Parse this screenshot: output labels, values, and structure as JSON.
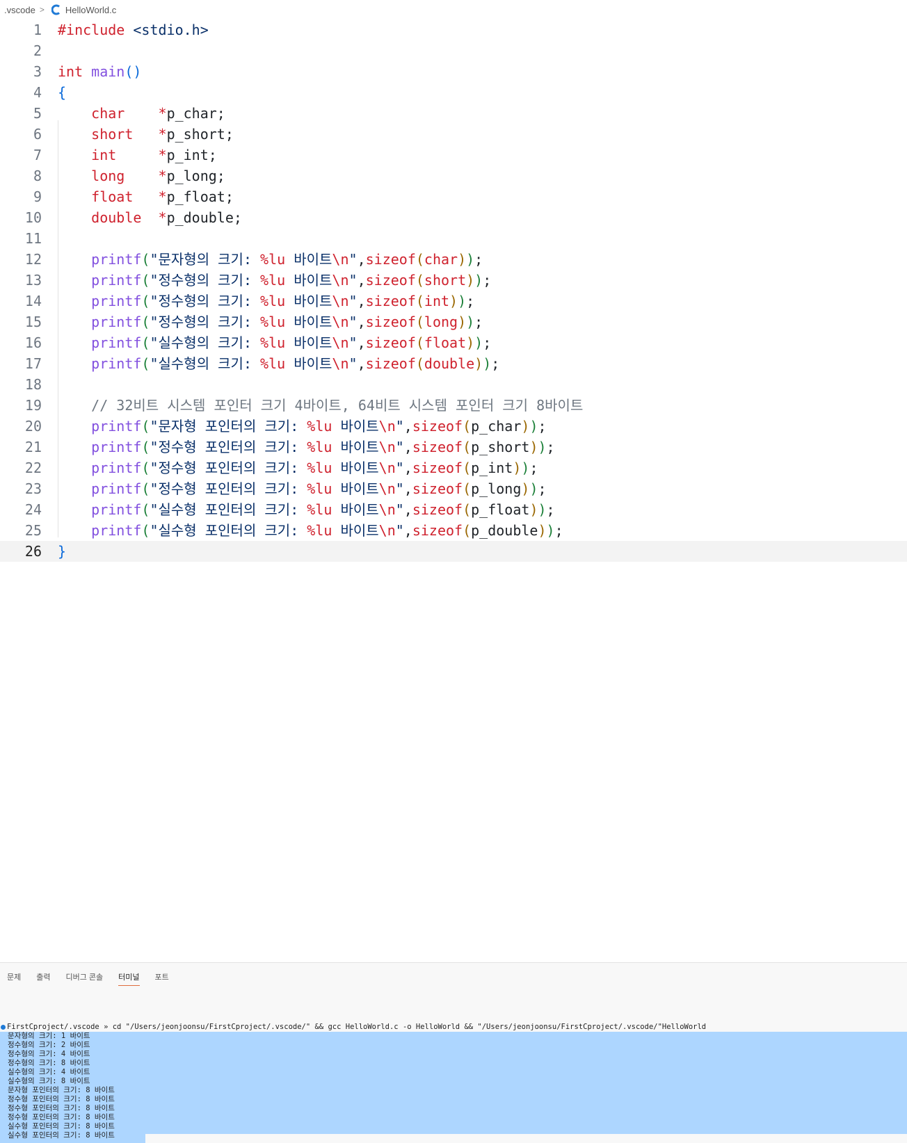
{
  "breadcrumb": {
    "folder": ".vscode",
    "file": "HelloWorld.c"
  },
  "editor": {
    "current_line": 26,
    "lines": [
      [
        {
          "t": "#include ",
          "c": "pp"
        },
        {
          "t": "<stdio.h>",
          "c": "str"
        }
      ],
      [],
      [
        {
          "t": "int",
          "c": "kw"
        },
        {
          "t": " ",
          "c": "id"
        },
        {
          "t": "main",
          "c": "fn"
        },
        {
          "t": "()",
          "c": "b1"
        }
      ],
      [
        {
          "t": "{",
          "c": "b1"
        }
      ],
      [
        {
          "t": "    ",
          "c": "id"
        },
        {
          "t": "char",
          "c": "kw"
        },
        {
          "t": "    ",
          "c": "id"
        },
        {
          "t": "*",
          "c": "ptr"
        },
        {
          "t": "p_char;",
          "c": "id"
        }
      ],
      [
        {
          "t": "    ",
          "c": "id"
        },
        {
          "t": "short",
          "c": "kw"
        },
        {
          "t": "   ",
          "c": "id"
        },
        {
          "t": "*",
          "c": "ptr"
        },
        {
          "t": "p_short;",
          "c": "id"
        }
      ],
      [
        {
          "t": "    ",
          "c": "id"
        },
        {
          "t": "int",
          "c": "kw"
        },
        {
          "t": "     ",
          "c": "id"
        },
        {
          "t": "*",
          "c": "ptr"
        },
        {
          "t": "p_int;",
          "c": "id"
        }
      ],
      [
        {
          "t": "    ",
          "c": "id"
        },
        {
          "t": "long",
          "c": "kw"
        },
        {
          "t": "    ",
          "c": "id"
        },
        {
          "t": "*",
          "c": "ptr"
        },
        {
          "t": "p_long;",
          "c": "id"
        }
      ],
      [
        {
          "t": "    ",
          "c": "id"
        },
        {
          "t": "float",
          "c": "kw"
        },
        {
          "t": "   ",
          "c": "id"
        },
        {
          "t": "*",
          "c": "ptr"
        },
        {
          "t": "p_float;",
          "c": "id"
        }
      ],
      [
        {
          "t": "    ",
          "c": "id"
        },
        {
          "t": "double",
          "c": "kw"
        },
        {
          "t": "  ",
          "c": "id"
        },
        {
          "t": "*",
          "c": "ptr"
        },
        {
          "t": "p_double;",
          "c": "id"
        }
      ],
      [],
      [
        {
          "t": "    ",
          "c": "id"
        },
        {
          "t": "printf",
          "c": "fn"
        },
        {
          "t": "(",
          "c": "b2"
        },
        {
          "t": "\"문자형의 크기: ",
          "c": "str"
        },
        {
          "t": "%lu",
          "c": "esc"
        },
        {
          "t": " 바이트",
          "c": "str"
        },
        {
          "t": "\\n",
          "c": "esc"
        },
        {
          "t": "\"",
          "c": "str"
        },
        {
          "t": ",",
          "c": "id"
        },
        {
          "t": "sizeof",
          "c": "kw"
        },
        {
          "t": "(",
          "c": "b3"
        },
        {
          "t": "char",
          "c": "kw"
        },
        {
          "t": ")",
          "c": "b3"
        },
        {
          "t": ")",
          "c": "b2"
        },
        {
          "t": ";",
          "c": "id"
        }
      ],
      [
        {
          "t": "    ",
          "c": "id"
        },
        {
          "t": "printf",
          "c": "fn"
        },
        {
          "t": "(",
          "c": "b2"
        },
        {
          "t": "\"정수형의 크기: ",
          "c": "str"
        },
        {
          "t": "%lu",
          "c": "esc"
        },
        {
          "t": " 바이트",
          "c": "str"
        },
        {
          "t": "\\n",
          "c": "esc"
        },
        {
          "t": "\"",
          "c": "str"
        },
        {
          "t": ",",
          "c": "id"
        },
        {
          "t": "sizeof",
          "c": "kw"
        },
        {
          "t": "(",
          "c": "b3"
        },
        {
          "t": "short",
          "c": "kw"
        },
        {
          "t": ")",
          "c": "b3"
        },
        {
          "t": ")",
          "c": "b2"
        },
        {
          "t": ";",
          "c": "id"
        }
      ],
      [
        {
          "t": "    ",
          "c": "id"
        },
        {
          "t": "printf",
          "c": "fn"
        },
        {
          "t": "(",
          "c": "b2"
        },
        {
          "t": "\"정수형의 크기: ",
          "c": "str"
        },
        {
          "t": "%lu",
          "c": "esc"
        },
        {
          "t": " 바이트",
          "c": "str"
        },
        {
          "t": "\\n",
          "c": "esc"
        },
        {
          "t": "\"",
          "c": "str"
        },
        {
          "t": ",",
          "c": "id"
        },
        {
          "t": "sizeof",
          "c": "kw"
        },
        {
          "t": "(",
          "c": "b3"
        },
        {
          "t": "int",
          "c": "kw"
        },
        {
          "t": ")",
          "c": "b3"
        },
        {
          "t": ")",
          "c": "b2"
        },
        {
          "t": ";",
          "c": "id"
        }
      ],
      [
        {
          "t": "    ",
          "c": "id"
        },
        {
          "t": "printf",
          "c": "fn"
        },
        {
          "t": "(",
          "c": "b2"
        },
        {
          "t": "\"정수형의 크기: ",
          "c": "str"
        },
        {
          "t": "%lu",
          "c": "esc"
        },
        {
          "t": " 바이트",
          "c": "str"
        },
        {
          "t": "\\n",
          "c": "esc"
        },
        {
          "t": "\"",
          "c": "str"
        },
        {
          "t": ",",
          "c": "id"
        },
        {
          "t": "sizeof",
          "c": "kw"
        },
        {
          "t": "(",
          "c": "b3"
        },
        {
          "t": "long",
          "c": "kw"
        },
        {
          "t": ")",
          "c": "b3"
        },
        {
          "t": ")",
          "c": "b2"
        },
        {
          "t": ";",
          "c": "id"
        }
      ],
      [
        {
          "t": "    ",
          "c": "id"
        },
        {
          "t": "printf",
          "c": "fn"
        },
        {
          "t": "(",
          "c": "b2"
        },
        {
          "t": "\"실수형의 크기: ",
          "c": "str"
        },
        {
          "t": "%lu",
          "c": "esc"
        },
        {
          "t": " 바이트",
          "c": "str"
        },
        {
          "t": "\\n",
          "c": "esc"
        },
        {
          "t": "\"",
          "c": "str"
        },
        {
          "t": ",",
          "c": "id"
        },
        {
          "t": "sizeof",
          "c": "kw"
        },
        {
          "t": "(",
          "c": "b3"
        },
        {
          "t": "float",
          "c": "kw"
        },
        {
          "t": ")",
          "c": "b3"
        },
        {
          "t": ")",
          "c": "b2"
        },
        {
          "t": ";",
          "c": "id"
        }
      ],
      [
        {
          "t": "    ",
          "c": "id"
        },
        {
          "t": "printf",
          "c": "fn"
        },
        {
          "t": "(",
          "c": "b2"
        },
        {
          "t": "\"실수형의 크기: ",
          "c": "str"
        },
        {
          "t": "%lu",
          "c": "esc"
        },
        {
          "t": " 바이트",
          "c": "str"
        },
        {
          "t": "\\n",
          "c": "esc"
        },
        {
          "t": "\"",
          "c": "str"
        },
        {
          "t": ",",
          "c": "id"
        },
        {
          "t": "sizeof",
          "c": "kw"
        },
        {
          "t": "(",
          "c": "b3"
        },
        {
          "t": "double",
          "c": "kw"
        },
        {
          "t": ")",
          "c": "b3"
        },
        {
          "t": ")",
          "c": "b2"
        },
        {
          "t": ";",
          "c": "id"
        }
      ],
      [],
      [
        {
          "t": "    ",
          "c": "id"
        },
        {
          "t": "// 32비트 시스템 포인터 크기 4바이트, 64비트 시스템 포인터 크기 8바이트",
          "c": "cm"
        }
      ],
      [
        {
          "t": "    ",
          "c": "id"
        },
        {
          "t": "printf",
          "c": "fn"
        },
        {
          "t": "(",
          "c": "b2"
        },
        {
          "t": "\"문자형 포인터의 크기: ",
          "c": "str"
        },
        {
          "t": "%lu",
          "c": "esc"
        },
        {
          "t": " 바이트",
          "c": "str"
        },
        {
          "t": "\\n",
          "c": "esc"
        },
        {
          "t": "\"",
          "c": "str"
        },
        {
          "t": ",",
          "c": "id"
        },
        {
          "t": "sizeof",
          "c": "kw"
        },
        {
          "t": "(",
          "c": "b3"
        },
        {
          "t": "p_char",
          "c": "id"
        },
        {
          "t": ")",
          "c": "b3"
        },
        {
          "t": ")",
          "c": "b2"
        },
        {
          "t": ";",
          "c": "id"
        }
      ],
      [
        {
          "t": "    ",
          "c": "id"
        },
        {
          "t": "printf",
          "c": "fn"
        },
        {
          "t": "(",
          "c": "b2"
        },
        {
          "t": "\"정수형 포인터의 크기: ",
          "c": "str"
        },
        {
          "t": "%lu",
          "c": "esc"
        },
        {
          "t": " 바이트",
          "c": "str"
        },
        {
          "t": "\\n",
          "c": "esc"
        },
        {
          "t": "\"",
          "c": "str"
        },
        {
          "t": ",",
          "c": "id"
        },
        {
          "t": "sizeof",
          "c": "kw"
        },
        {
          "t": "(",
          "c": "b3"
        },
        {
          "t": "p_short",
          "c": "id"
        },
        {
          "t": ")",
          "c": "b3"
        },
        {
          "t": ")",
          "c": "b2"
        },
        {
          "t": ";",
          "c": "id"
        }
      ],
      [
        {
          "t": "    ",
          "c": "id"
        },
        {
          "t": "printf",
          "c": "fn"
        },
        {
          "t": "(",
          "c": "b2"
        },
        {
          "t": "\"정수형 포인터의 크기: ",
          "c": "str"
        },
        {
          "t": "%lu",
          "c": "esc"
        },
        {
          "t": " 바이트",
          "c": "str"
        },
        {
          "t": "\\n",
          "c": "esc"
        },
        {
          "t": "\"",
          "c": "str"
        },
        {
          "t": ",",
          "c": "id"
        },
        {
          "t": "sizeof",
          "c": "kw"
        },
        {
          "t": "(",
          "c": "b3"
        },
        {
          "t": "p_int",
          "c": "id"
        },
        {
          "t": ")",
          "c": "b3"
        },
        {
          "t": ")",
          "c": "b2"
        },
        {
          "t": ";",
          "c": "id"
        }
      ],
      [
        {
          "t": "    ",
          "c": "id"
        },
        {
          "t": "printf",
          "c": "fn"
        },
        {
          "t": "(",
          "c": "b2"
        },
        {
          "t": "\"정수형 포인터의 크기: ",
          "c": "str"
        },
        {
          "t": "%lu",
          "c": "esc"
        },
        {
          "t": " 바이트",
          "c": "str"
        },
        {
          "t": "\\n",
          "c": "esc"
        },
        {
          "t": "\"",
          "c": "str"
        },
        {
          "t": ",",
          "c": "id"
        },
        {
          "t": "sizeof",
          "c": "kw"
        },
        {
          "t": "(",
          "c": "b3"
        },
        {
          "t": "p_long",
          "c": "id"
        },
        {
          "t": ")",
          "c": "b3"
        },
        {
          "t": ")",
          "c": "b2"
        },
        {
          "t": ";",
          "c": "id"
        }
      ],
      [
        {
          "t": "    ",
          "c": "id"
        },
        {
          "t": "printf",
          "c": "fn"
        },
        {
          "t": "(",
          "c": "b2"
        },
        {
          "t": "\"실수형 포인터의 크기: ",
          "c": "str"
        },
        {
          "t": "%lu",
          "c": "esc"
        },
        {
          "t": " 바이트",
          "c": "str"
        },
        {
          "t": "\\n",
          "c": "esc"
        },
        {
          "t": "\"",
          "c": "str"
        },
        {
          "t": ",",
          "c": "id"
        },
        {
          "t": "sizeof",
          "c": "kw"
        },
        {
          "t": "(",
          "c": "b3"
        },
        {
          "t": "p_float",
          "c": "id"
        },
        {
          "t": ")",
          "c": "b3"
        },
        {
          "t": ")",
          "c": "b2"
        },
        {
          "t": ";",
          "c": "id"
        }
      ],
      [
        {
          "t": "    ",
          "c": "id"
        },
        {
          "t": "printf",
          "c": "fn"
        },
        {
          "t": "(",
          "c": "b2"
        },
        {
          "t": "\"실수형 포인터의 크기: ",
          "c": "str"
        },
        {
          "t": "%lu",
          "c": "esc"
        },
        {
          "t": " 바이트",
          "c": "str"
        },
        {
          "t": "\\n",
          "c": "esc"
        },
        {
          "t": "\"",
          "c": "str"
        },
        {
          "t": ",",
          "c": "id"
        },
        {
          "t": "sizeof",
          "c": "kw"
        },
        {
          "t": "(",
          "c": "b3"
        },
        {
          "t": "p_double",
          "c": "id"
        },
        {
          "t": ")",
          "c": "b3"
        },
        {
          "t": ")",
          "c": "b2"
        },
        {
          "t": ";",
          "c": "id"
        }
      ],
      [
        {
          "t": "}",
          "c": "b1"
        }
      ]
    ]
  },
  "panel": {
    "tabs": [
      {
        "label": "문제",
        "active": false
      },
      {
        "label": "출력",
        "active": false
      },
      {
        "label": "디버그 콘솔",
        "active": false
      },
      {
        "label": "터미널",
        "active": true
      },
      {
        "label": "포트",
        "active": false
      }
    ],
    "terminal": {
      "command": "FirstCproject/.vscode » cd \"/Users/jeonjoonsu/FirstCproject/.vscode/\" && gcc HelloWorld.c -o HelloWorld && \"/Users/jeonjoonsu/FirstCproject/.vscode/\"HelloWorld",
      "output": [
        "문자형의 크기: 1 바이트",
        "정수형의 크기: 2 바이트",
        "정수형의 크기: 4 바이트",
        "정수형의 크기: 8 바이트",
        "실수형의 크기: 4 바이트",
        "실수형의 크기: 8 바이트",
        "문자형 포인터의 크기: 8 바이트",
        "정수형 포인터의 크기: 8 바이트",
        "정수형 포인터의 크기: 8 바이트",
        "정수형 포인터의 크기: 8 바이트",
        "실수형 포인터의 크기: 8 바이트",
        "실수형 포인터의 크기: 8 바이트"
      ]
    }
  },
  "colors": {
    "keyword": "#cf222e",
    "function": "#8250df",
    "string": "#0a3069",
    "comment": "#6e7781",
    "selection": "#add6ff",
    "active_tab_underline": "#e06b3c",
    "terminal_dot": "#1f7ad6"
  },
  "icons": {
    "file_type": "c-language-icon",
    "separator": "chevron-right-icon",
    "terminal_status": "status-dot-icon"
  }
}
